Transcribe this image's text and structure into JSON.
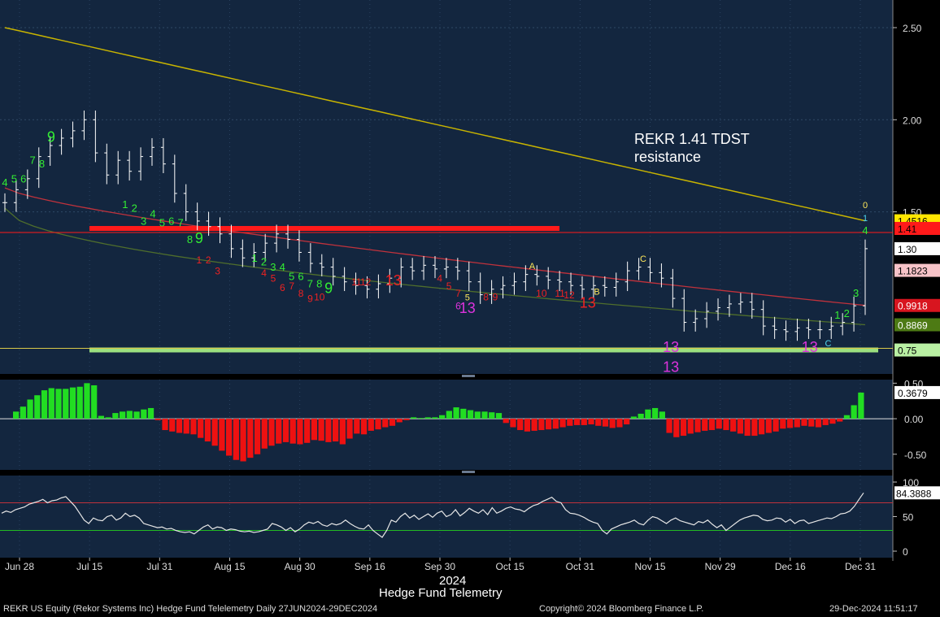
{
  "window": {
    "footer_left": "REKR US Equity (Rekor Systems Inc) Hedge Fund Telelemetry  Daily 27JUN2024-29DEC2024",
    "footer_center": "Copyright© 2024 Bloomberg Finance L.P.",
    "footer_right": "29-Dec-2024 11:51:17",
    "bottom_title": "Hedge Fund Telemetry",
    "year_label": "2024"
  },
  "annotation": {
    "line1": "REKR 1.41 TDST",
    "line2": "resistance"
  },
  "colors": {
    "background": "#13263f",
    "candle": "#ffffff",
    "ma_slow": "#c8b400",
    "ma_mid": "#c0323c",
    "ma_fast": "#4f6e2c",
    "tdst_line": "#ff1a1a",
    "support_line": "#9be07f",
    "hist_pos": "#22dd22",
    "hist_neg": "#ee1111",
    "rsi_line": "#e6e6e6",
    "rsi_upper": "#c0323c",
    "rsi_lower": "#22bb22",
    "count_green": "#33ee33",
    "count_red": "#ee2222",
    "count_magenta": "#dd33dd"
  },
  "chart_data": [
    {
      "type": "line",
      "panel": "price",
      "y_ticks": [
        "2.50",
        "2.00",
        "1.50"
      ],
      "ylim": [
        0.62,
        2.65
      ],
      "x_ticks": [
        "Jun 28",
        "Jul 15",
        "Jul 31",
        "Aug 15",
        "Aug 30",
        "Sep 16",
        "Sep 30",
        "Oct 15",
        "Oct 31",
        "Nov 15",
        "Nov 29",
        "Dec 16",
        "Dec 31"
      ],
      "price_close": [
        1.55,
        1.62,
        1.68,
        1.8,
        1.86,
        1.9,
        1.94,
        2.0,
        1.82,
        1.7,
        1.78,
        1.72,
        1.8,
        1.85,
        1.76,
        1.6,
        1.5,
        1.45,
        1.42,
        1.38,
        1.3,
        1.25,
        1.28,
        1.33,
        1.38,
        1.35,
        1.28,
        1.22,
        1.2,
        1.15,
        1.12,
        1.1,
        1.08,
        1.11,
        1.14,
        1.2,
        1.18,
        1.21,
        1.19,
        1.2,
        1.18,
        1.12,
        1.05,
        1.08,
        1.1,
        1.12,
        1.16,
        1.15,
        1.13,
        1.12,
        1.1,
        1.08,
        1.1,
        1.09,
        1.12,
        1.18,
        1.2,
        1.17,
        1.14,
        1.03,
        0.9,
        0.92,
        0.96,
        0.98,
        1.0,
        1.01,
        0.97,
        0.88,
        0.86,
        0.85,
        0.87,
        0.86,
        0.86,
        0.88,
        0.9,
        0.99,
        1.3
      ],
      "legend_labels": [
        {
          "text": "1.4516",
          "bg": "#ffe600",
          "fg": "#000000"
        },
        {
          "text": "1.41",
          "bg": "#ff1a1a",
          "fg": "#000000"
        },
        {
          "text": "1.30",
          "bg": "#ffffff",
          "fg": "#000000"
        },
        {
          "text": "1.1823",
          "bg": "#f7c3c8",
          "fg": "#000000"
        },
        {
          "text": "0.9918",
          "bg": "#d8151f",
          "fg": "#ffffff"
        },
        {
          "text": "0.8869",
          "bg": "#4d7a14",
          "fg": "#ffffff"
        },
        {
          "text": "0.75",
          "bg": "#b9f0a3",
          "fg": "#000000"
        }
      ],
      "label_values": [
        1.4516,
        1.41,
        1.3,
        1.1823,
        0.9918,
        0.8869,
        0.75
      ],
      "tdst_resistance": 1.41,
      "support": 0.75,
      "ma_slow_range": [
        2.5,
        1.4516
      ],
      "ma_mid_range": [
        1.63,
        0.9918
      ],
      "ma_fast_range": [
        1.52,
        0.8869
      ],
      "counts": [
        {
          "t": "4",
          "idx": 0,
          "v": 1.64,
          "c": "green",
          "s": 13
        },
        {
          "t": "5",
          "idx": 1,
          "v": 1.66,
          "c": "green",
          "s": 13
        },
        {
          "t": "6",
          "idx": 2,
          "v": 1.66,
          "c": "green",
          "s": 13
        },
        {
          "t": "7",
          "idx": 3,
          "v": 1.76,
          "c": "green",
          "s": 13
        },
        {
          "t": "8",
          "idx": 4,
          "v": 1.74,
          "c": "green",
          "s": 13
        },
        {
          "t": "9",
          "idx": 5,
          "v": 1.88,
          "c": "green",
          "s": 18
        },
        {
          "t": "1",
          "idx": 13,
          "v": 1.52,
          "c": "green",
          "s": 13
        },
        {
          "t": "2",
          "idx": 14,
          "v": 1.5,
          "c": "green",
          "s": 13
        },
        {
          "t": "3",
          "idx": 15,
          "v": 1.43,
          "c": "green",
          "s": 13
        },
        {
          "t": "4",
          "idx": 16,
          "v": 1.47,
          "c": "green",
          "s": 13
        },
        {
          "t": "5",
          "idx": 17,
          "v": 1.42,
          "c": "green",
          "s": 13
        },
        {
          "t": "6",
          "idx": 18,
          "v": 1.43,
          "c": "green",
          "s": 13
        },
        {
          "t": "7",
          "idx": 19,
          "v": 1.42,
          "c": "green",
          "s": 13
        },
        {
          "t": "8",
          "idx": 20,
          "v": 1.33,
          "c": "green",
          "s": 13
        },
        {
          "t": "9",
          "idx": 21,
          "v": 1.33,
          "c": "green",
          "s": 18
        },
        {
          "t": "1",
          "idx": 21,
          "v": 1.22,
          "c": "red",
          "s": 12
        },
        {
          "t": "2",
          "idx": 22,
          "v": 1.22,
          "c": "red",
          "s": 12
        },
        {
          "t": "3",
          "idx": 23,
          "v": 1.16,
          "c": "red",
          "s": 12
        },
        {
          "t": "1",
          "idx": 27,
          "v": 1.23,
          "c": "green",
          "s": 13
        },
        {
          "t": "2",
          "idx": 28,
          "v": 1.21,
          "c": "green",
          "s": 13
        },
        {
          "t": "3",
          "idx": 29,
          "v": 1.18,
          "c": "green",
          "s": 13
        },
        {
          "t": "4",
          "idx": 30,
          "v": 1.18,
          "c": "green",
          "s": 13
        },
        {
          "t": "5",
          "idx": 31,
          "v": 1.13,
          "c": "green",
          "s": 13
        },
        {
          "t": "6",
          "idx": 32,
          "v": 1.13,
          "c": "green",
          "s": 13
        },
        {
          "t": "7",
          "idx": 33,
          "v": 1.09,
          "c": "green",
          "s": 13
        },
        {
          "t": "8",
          "idx": 34,
          "v": 1.09,
          "c": "green",
          "s": 13
        },
        {
          "t": "9",
          "idx": 35,
          "v": 1.06,
          "c": "green",
          "s": 18
        },
        {
          "t": "4",
          "idx": 28,
          "v": 1.15,
          "c": "red",
          "s": 12
        },
        {
          "t": "5",
          "idx": 29,
          "v": 1.12,
          "c": "red",
          "s": 12
        },
        {
          "t": "6",
          "idx": 30,
          "v": 1.07,
          "c": "red",
          "s": 12
        },
        {
          "t": "7",
          "idx": 31,
          "v": 1.08,
          "c": "red",
          "s": 12
        },
        {
          "t": "8",
          "idx": 32,
          "v": 1.04,
          "c": "red",
          "s": 12
        },
        {
          "t": "9",
          "idx": 33,
          "v": 1.01,
          "c": "red",
          "s": 12
        },
        {
          "t": "10",
          "idx": 34,
          "v": 1.02,
          "c": "red",
          "s": 12
        },
        {
          "t": "11",
          "idx": 38,
          "v": 1.1,
          "c": "red",
          "s": 12
        },
        {
          "t": "12",
          "idx": 39,
          "v": 1.1,
          "c": "red",
          "s": 12
        },
        {
          "t": "13",
          "idx": 42,
          "v": 1.1,
          "c": "red",
          "s": 18
        },
        {
          "t": "4",
          "idx": 47,
          "v": 1.12,
          "c": "red",
          "s": 12
        },
        {
          "t": "5",
          "idx": 48,
          "v": 1.08,
          "c": "red",
          "s": 12
        },
        {
          "t": "7",
          "idx": 49,
          "v": 1.04,
          "c": "red",
          "s": 12
        },
        {
          "t": "5",
          "idx": 50,
          "v": 1.02,
          "c": "yellow",
          "s": 11
        },
        {
          "t": "8",
          "idx": 52,
          "v": 1.02,
          "c": "red",
          "s": 12
        },
        {
          "t": "9",
          "idx": 53,
          "v": 1.02,
          "c": "red",
          "s": 12
        },
        {
          "t": "6",
          "idx": 49,
          "v": 0.97,
          "c": "magenta",
          "s": 12
        },
        {
          "t": "13",
          "idx": 50,
          "v": 0.95,
          "c": "magenta",
          "s": 18
        },
        {
          "t": "10",
          "idx": 58,
          "v": 1.04,
          "c": "red",
          "s": 12
        },
        {
          "t": "11",
          "idx": 60,
          "v": 1.04,
          "c": "red",
          "s": 12
        },
        {
          "t": "12",
          "idx": 61,
          "v": 1.03,
          "c": "red",
          "s": 12
        },
        {
          "t": "13",
          "idx": 63,
          "v": 0.98,
          "c": "red",
          "s": 18
        },
        {
          "t": "A",
          "idx": 57,
          "v": 1.19,
          "c": "yellow",
          "s": 11
        },
        {
          "t": "B",
          "idx": 64,
          "v": 1.05,
          "c": "yellow",
          "s": 11
        },
        {
          "t": "C",
          "idx": 69,
          "v": 1.23,
          "c": "yellow",
          "s": 11
        },
        {
          "t": "13",
          "idx": 72,
          "v": 0.74,
          "c": "magenta",
          "s": 18
        },
        {
          "t": "13",
          "idx": 72,
          "v": 0.63,
          "c": "magenta",
          "s": 18
        },
        {
          "t": "13",
          "idx": 87,
          "v": 0.74,
          "c": "magenta",
          "s": 18
        },
        {
          "t": "C",
          "idx": 89,
          "v": 0.77,
          "c": "cyan",
          "s": 11
        },
        {
          "t": "1",
          "idx": 90,
          "v": 0.92,
          "c": "green",
          "s": 13
        },
        {
          "t": "2",
          "idx": 91,
          "v": 0.93,
          "c": "green",
          "s": 13
        },
        {
          "t": "3",
          "idx": 92,
          "v": 1.04,
          "c": "green",
          "s": 13
        },
        {
          "t": "4",
          "idx": 93,
          "v": 1.38,
          "c": "green",
          "s": 13
        },
        {
          "t": "1",
          "idx": 93,
          "v": 1.45,
          "c": "cyan",
          "s": 11
        },
        {
          "t": "0",
          "idx": 93,
          "v": 1.52,
          "c": "yellow",
          "s": 11
        }
      ]
    },
    {
      "type": "bar",
      "panel": "histogram",
      "y_ticks": [
        "0.50",
        "0.00",
        "-0.50"
      ],
      "ylim": [
        -0.72,
        0.55
      ],
      "values": [
        0.1,
        0.17,
        0.27,
        0.33,
        0.4,
        0.43,
        0.42,
        0.42,
        0.44,
        0.45,
        0.5,
        0.47,
        0.04,
        0.02,
        0.08,
        0.1,
        0.11,
        0.1,
        0.13,
        0.15,
        -0.02,
        -0.16,
        -0.18,
        -0.2,
        -0.21,
        -0.22,
        -0.27,
        -0.32,
        -0.38,
        -0.45,
        -0.52,
        -0.58,
        -0.6,
        -0.55,
        -0.5,
        -0.42,
        -0.38,
        -0.35,
        -0.33,
        -0.35,
        -0.36,
        -0.34,
        -0.3,
        -0.31,
        -0.33,
        -0.32,
        -0.36,
        -0.28,
        -0.21,
        -0.22,
        -0.17,
        -0.15,
        -0.12,
        -0.1,
        -0.05,
        -0.02,
        0.02,
        0.01,
        0.02,
        0.02,
        0.05,
        0.11,
        0.16,
        0.14,
        0.12,
        0.1,
        0.1,
        0.09,
        0.08,
        -0.06,
        -0.12,
        -0.16,
        -0.18,
        -0.17,
        -0.16,
        -0.15,
        -0.14,
        -0.12,
        -0.1,
        -0.09,
        -0.09,
        -0.08,
        -0.1,
        -0.11,
        -0.13,
        -0.12,
        -0.08,
        0.03,
        0.07,
        0.13,
        0.15,
        0.1,
        -0.2,
        -0.26,
        -0.24,
        -0.21,
        -0.19,
        -0.17,
        -0.16,
        -0.14,
        -0.16,
        -0.18,
        -0.21,
        -0.24,
        -0.24,
        -0.22,
        -0.2,
        -0.18,
        -0.14,
        -0.13,
        -0.12,
        -0.1,
        -0.11,
        -0.12,
        -0.09,
        -0.07,
        -0.04,
        0.05,
        0.19,
        0.3679
      ],
      "label": "0.3679"
    },
    {
      "type": "line",
      "panel": "oscillator",
      "y_ticks": [
        "100",
        "50",
        "0"
      ],
      "ylim": [
        0,
        100
      ],
      "upper": 70,
      "lower": 30,
      "values": [
        55,
        58,
        56,
        60,
        62,
        64,
        68,
        70,
        72,
        75,
        70,
        73,
        74,
        77,
        79,
        72,
        65,
        55,
        45,
        40,
        48,
        45,
        44,
        50,
        52,
        45,
        48,
        55,
        50,
        52,
        48,
        40,
        38,
        36,
        34,
        35,
        32,
        33,
        30,
        28,
        27,
        28,
        25,
        30,
        35,
        38,
        32,
        35,
        34,
        30,
        32,
        31,
        29,
        28,
        29,
        27,
        28,
        30,
        32,
        40,
        38,
        35,
        30,
        34,
        28,
        32,
        38,
        42,
        40,
        43,
        38,
        36,
        40,
        38,
        40,
        45,
        40,
        36,
        33,
        32,
        38,
        30,
        25,
        20,
        30,
        45,
        42,
        50,
        55,
        48,
        52,
        46,
        50,
        54,
        49,
        55,
        58,
        50,
        53,
        60,
        51,
        56,
        62,
        58,
        55,
        60,
        53,
        63,
        55,
        58,
        62,
        64,
        61,
        60,
        57,
        62,
        66,
        68,
        72,
        75,
        78,
        72,
        70,
        60,
        55,
        54,
        52,
        49,
        45,
        42,
        40,
        30,
        25,
        32,
        35,
        38,
        40,
        42,
        45,
        40,
        38,
        45,
        50,
        48,
        44,
        40,
        45,
        48,
        44,
        42,
        40,
        38,
        43,
        41,
        45,
        39,
        34,
        38,
        30,
        35,
        40,
        45,
        48,
        50,
        52,
        51,
        46,
        44,
        45,
        48,
        47,
        42,
        46,
        40,
        44,
        45,
        40,
        42,
        44,
        46,
        48,
        47,
        50,
        54,
        55,
        58,
        65,
        75,
        84.3888
      ],
      "label": "84.3888",
      "threshold_labels": [
        "70",
        "30"
      ]
    }
  ]
}
